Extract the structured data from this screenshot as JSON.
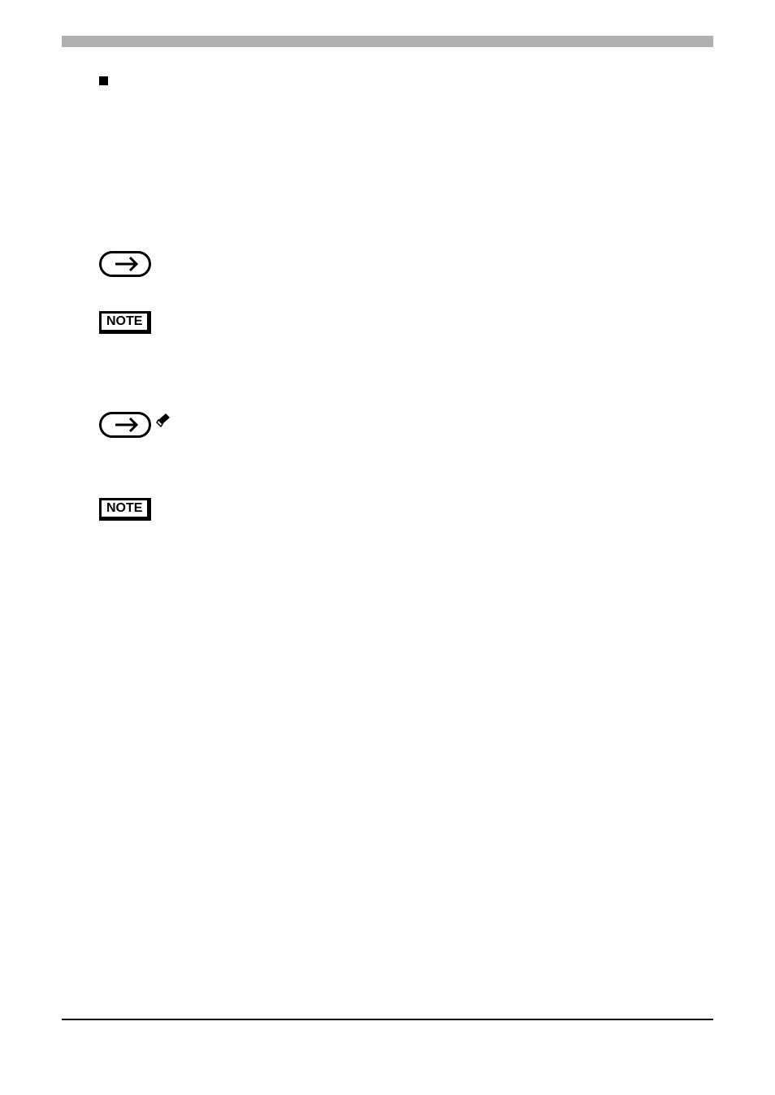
{
  "heading": "",
  "note_label": "NOTE"
}
